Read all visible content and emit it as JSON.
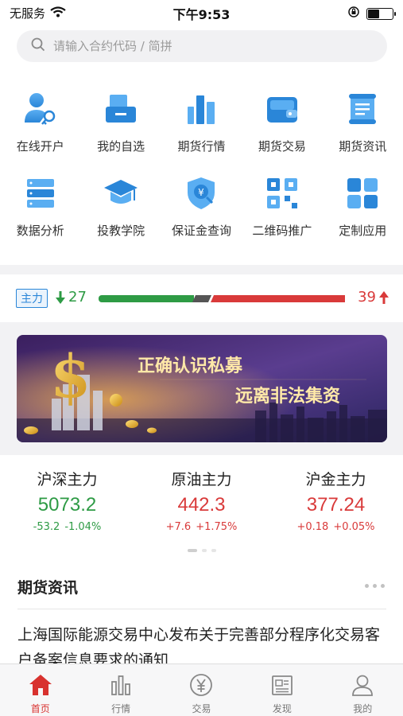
{
  "status_bar": {
    "carrier": "无服务",
    "time": "下午9:53"
  },
  "search": {
    "placeholder": "请输入合约代码 / 简拼"
  },
  "grid": {
    "items": [
      {
        "label": "在线开户",
        "icon": "user-account-icon"
      },
      {
        "label": "我的自选",
        "icon": "favorites-icon"
      },
      {
        "label": "期货行情",
        "icon": "bar-chart-icon"
      },
      {
        "label": "期货交易",
        "icon": "wallet-icon"
      },
      {
        "label": "期货资讯",
        "icon": "news-scroll-icon"
      },
      {
        "label": "数据分析",
        "icon": "database-icon"
      },
      {
        "label": "投教学院",
        "icon": "graduation-cap-icon"
      },
      {
        "label": "保证金查询",
        "icon": "deposit-shield-icon"
      },
      {
        "label": "二维码推广",
        "icon": "qr-code-icon"
      },
      {
        "label": "定制应用",
        "icon": "custom-apps-icon"
      }
    ]
  },
  "force": {
    "badge": "主力",
    "down": "27",
    "up": "39"
  },
  "banner": {
    "line1": "正确认识私募",
    "line2": "远离非法集资"
  },
  "indexes": [
    {
      "name": "沪深主力",
      "value": "5073.2",
      "change": "-53.2",
      "percent": "-1.04%"
    },
    {
      "name": "原油主力",
      "value": "442.3",
      "change": "+7.6",
      "percent": "+1.75%"
    },
    {
      "name": "沪金主力",
      "value": "377.24",
      "change": "+0.18",
      "percent": "+0.05%"
    }
  ],
  "news": {
    "title": "期货资讯",
    "items": [
      "上海国际能源交易中心发布关于完善部分程序化交易客户备案信息要求的通知"
    ]
  },
  "tabbar": {
    "tabs": [
      {
        "label": "首页",
        "icon": "home-icon"
      },
      {
        "label": "行情",
        "icon": "market-bars-icon"
      },
      {
        "label": "交易",
        "icon": "yen-coin-icon"
      },
      {
        "label": "发现",
        "icon": "discover-news-icon"
      },
      {
        "label": "我的",
        "icon": "profile-icon"
      }
    ]
  },
  "colors": {
    "accent_blue": "#2a86d8",
    "up_red": "#d93a3a",
    "down_green": "#2e9b45",
    "tab_active": "#d8322f"
  }
}
